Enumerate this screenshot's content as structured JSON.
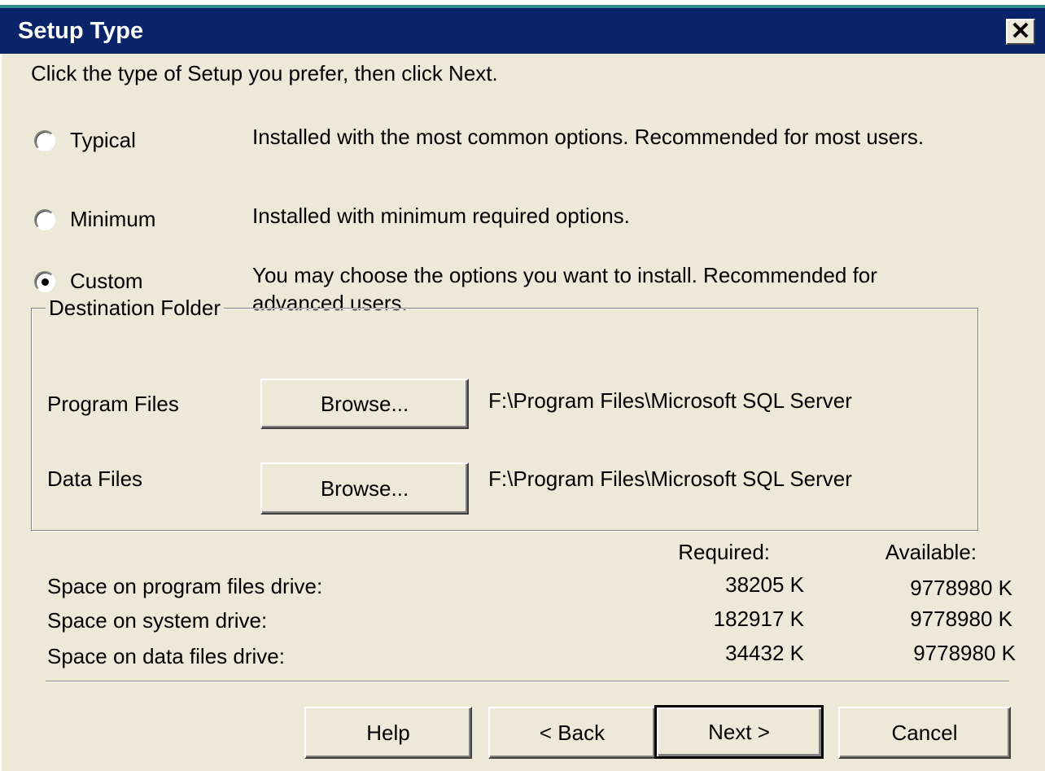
{
  "window": {
    "title": "Setup Type",
    "close_icon": "close-icon"
  },
  "instruction": "Click the type of Setup you prefer, then click Next.",
  "setup_options": [
    {
      "label": "Typical",
      "description": "Installed with the most common options. Recommended for most users.",
      "selected": false
    },
    {
      "label": "Minimum",
      "description": "Installed with minimum required options.",
      "selected": false
    },
    {
      "label": "Custom",
      "description_line1": "You may choose the options you want to install. Recommended for",
      "description_line2": "advanced users.",
      "selected": true
    }
  ],
  "destination": {
    "legend": "Destination Folder",
    "program_files": {
      "label": "Program Files",
      "button": "Browse...",
      "path": "F:\\Program Files\\Microsoft SQL Server"
    },
    "data_files": {
      "label": "Data Files",
      "button": "Browse...",
      "path": "F:\\Program Files\\Microsoft SQL Server"
    }
  },
  "space": {
    "required_header": "Required:",
    "available_header": "Available:",
    "rows": [
      {
        "label": "Space on program files drive:",
        "required": "38205 K",
        "available": "9778980 K"
      },
      {
        "label": "Space on system drive:",
        "required": "182917 K",
        "available": "9778980 K"
      },
      {
        "label": "Space on data files drive:",
        "required": "34432 K",
        "available": "9778980 K"
      }
    ]
  },
  "buttons": {
    "help": "Help",
    "back": "< Back",
    "next": "Next >",
    "cancel": "Cancel"
  },
  "colors": {
    "titlebar": "#0a246a",
    "dialog_bg": "#ECE9D8"
  }
}
